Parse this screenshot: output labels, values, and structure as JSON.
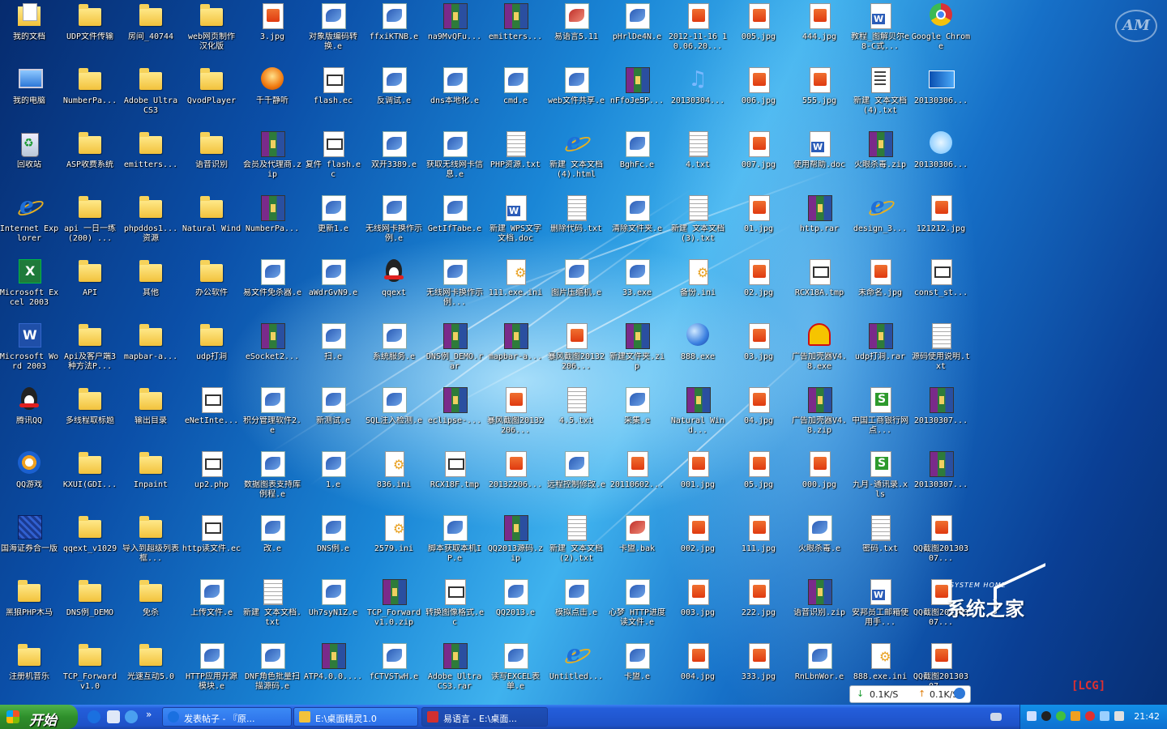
{
  "desktop": {
    "icons": [
      {
        "label": "我的文档",
        "type": "mydocs"
      },
      {
        "label": "我的电脑",
        "type": "computer"
      },
      {
        "label": "回收站",
        "type": "recycle"
      },
      {
        "label": "Internet Explorer",
        "type": "ie"
      },
      {
        "label": "Microsoft Excel 2003",
        "type": "excelapp"
      },
      {
        "label": "Microsoft Word 2003",
        "type": "wordapp"
      },
      {
        "label": "腾讯QQ",
        "type": "qq"
      },
      {
        "label": "QQ游戏",
        "type": "qqgame"
      },
      {
        "label": "国海证券合一版",
        "type": "cert"
      },
      {
        "label": "黑狼PHP木马",
        "type": "folder"
      },
      {
        "label": "注册机音乐",
        "type": "folder"
      },
      {
        "label": "UDP文件传输",
        "type": "folder"
      },
      {
        "label": "NumberPa...",
        "type": "folder"
      },
      {
        "label": "ASP收费系统",
        "type": "folder"
      },
      {
        "label": "api 一日一练(200) ...",
        "type": "folder"
      },
      {
        "label": "API",
        "type": "folder"
      },
      {
        "label": "Api及客户端3种方法P...",
        "type": "folder"
      },
      {
        "label": "多线程取标题",
        "type": "folder"
      },
      {
        "label": "KXUI(GDI...",
        "type": "folder"
      },
      {
        "label": "qqext_v1029",
        "type": "folder"
      },
      {
        "label": "DNS例_DEMO",
        "type": "folder"
      },
      {
        "label": "TCP_Forward v1.0",
        "type": "folder"
      },
      {
        "label": "房间_40744",
        "type": "folder"
      },
      {
        "label": "Adobe Ultra CS3",
        "type": "folder"
      },
      {
        "label": "emitters...",
        "type": "folder"
      },
      {
        "label": "phpddos1...资源",
        "type": "folder"
      },
      {
        "label": "其他",
        "type": "folder"
      },
      {
        "label": "mapbar-a...",
        "type": "folder"
      },
      {
        "label": "输出目录",
        "type": "folder"
      },
      {
        "label": "Inpaint",
        "type": "folder"
      },
      {
        "label": "导入到超级列表框...",
        "type": "folder"
      },
      {
        "label": "免杀",
        "type": "folder"
      },
      {
        "label": "光速互动5.0",
        "type": "folder"
      },
      {
        "label": "web网页制作 汉化版",
        "type": "folder"
      },
      {
        "label": "QvodPlayer",
        "type": "folder"
      },
      {
        "label": "语音识别",
        "type": "folder"
      },
      {
        "label": "Natural Wind",
        "type": "folder"
      },
      {
        "label": "办公软件",
        "type": "folder"
      },
      {
        "label": "udp打洞",
        "type": "folder"
      },
      {
        "label": "eNetInte...",
        "type": "ec"
      },
      {
        "label": "up2.php",
        "type": "ec"
      },
      {
        "label": "http读文件.ec",
        "type": "ec"
      },
      {
        "label": "上传文件.e",
        "type": "exe"
      },
      {
        "label": "HTTP应用开源模块.e",
        "type": "exe"
      },
      {
        "label": "3.jpg",
        "type": "jpg"
      },
      {
        "label": "千千静听",
        "type": "ttjt"
      },
      {
        "label": "会员及代理商.zip",
        "type": "rar"
      },
      {
        "label": "NumberPa...",
        "type": "rar"
      },
      {
        "label": "易文件免杀器.e",
        "type": "exe"
      },
      {
        "label": "eSocket2...",
        "type": "rar"
      },
      {
        "label": "积分管理软件2.e",
        "type": "exe"
      },
      {
        "label": "数据图表支持库例程.e",
        "type": "exe"
      },
      {
        "label": "改.e",
        "type": "exe"
      },
      {
        "label": "新建 文本文档.txt",
        "type": "txt"
      },
      {
        "label": "DNF角色批量扫描源码.e",
        "type": "exe"
      },
      {
        "label": "对象版编码转换.e",
        "type": "exe"
      },
      {
        "label": "flash.ec",
        "type": "ec"
      },
      {
        "label": "复件 flash.ec",
        "type": "ec"
      },
      {
        "label": "更新1.e",
        "type": "exe"
      },
      {
        "label": "aWdrGvN9.e",
        "type": "exe"
      },
      {
        "label": "扫.e",
        "type": "exe"
      },
      {
        "label": "新测试.e",
        "type": "exe"
      },
      {
        "label": "1.e",
        "type": "exe"
      },
      {
        "label": "DNS例.e",
        "type": "exe"
      },
      {
        "label": "Uh7syN1Z.e",
        "type": "exe"
      },
      {
        "label": "ATP4.0.0....",
        "type": "rar"
      },
      {
        "label": "ffxiKTNB.e",
        "type": "exe"
      },
      {
        "label": "反调试.e",
        "type": "exe"
      },
      {
        "label": "双开3389.e",
        "type": "exe"
      },
      {
        "label": "无线网卡换作示例.e",
        "type": "exe"
      },
      {
        "label": "qqext",
        "type": "qq"
      },
      {
        "label": "系统服务.e",
        "type": "exe"
      },
      {
        "label": "SQL注入检测.e",
        "type": "exe"
      },
      {
        "label": "836.ini",
        "type": "ini"
      },
      {
        "label": "2579.ini",
        "type": "ini"
      },
      {
        "label": "TCP_Forward v1.0.zip",
        "type": "rar"
      },
      {
        "label": "fCTVSTwH.e",
        "type": "exe"
      },
      {
        "label": "na9MvQFu...",
        "type": "rar"
      },
      {
        "label": "dns本地化.e",
        "type": "exe"
      },
      {
        "label": "获取无线网卡信息.e",
        "type": "exe"
      },
      {
        "label": "GetIfTabe.e",
        "type": "exe"
      },
      {
        "label": "无线网卡换作示例...",
        "type": "exe"
      },
      {
        "label": "DNS例_DEMO.rar",
        "type": "rar"
      },
      {
        "label": "eclipse-...",
        "type": "rar"
      },
      {
        "label": "RCX18F.tmp",
        "type": "ec"
      },
      {
        "label": "脚本获取本机IP.e",
        "type": "exe"
      },
      {
        "label": "转换图像格式.ec",
        "type": "ec"
      },
      {
        "label": "Adobe Ultra CS3.rar",
        "type": "rar"
      },
      {
        "label": "emitters...",
        "type": "rar"
      },
      {
        "label": "cmd.e",
        "type": "exe"
      },
      {
        "label": "PHP资源.txt",
        "type": "txt"
      },
      {
        "label": "新建 WPS文字 文档.doc",
        "type": "doc"
      },
      {
        "label": "111.exe.ini",
        "type": "ini"
      },
      {
        "label": "mapbar-a...",
        "type": "rar"
      },
      {
        "label": "暴风截图20132206...",
        "type": "jpg"
      },
      {
        "label": "20132206...",
        "type": "jpg"
      },
      {
        "label": "QQ2013源码.zip",
        "type": "rar"
      },
      {
        "label": "QQ2013.e",
        "type": "exe"
      },
      {
        "label": "读写EXCEL表单.e",
        "type": "exe"
      },
      {
        "label": "易语言5.11",
        "type": "exe",
        "red": true
      },
      {
        "label": "web文件共享.e",
        "type": "exe"
      },
      {
        "label": "新建 文本文档 (4).html",
        "type": "ie"
      },
      {
        "label": "删除代码.txt",
        "type": "txt"
      },
      {
        "label": "图片压缩机.e",
        "type": "exe"
      },
      {
        "label": "暴风截图20132206...",
        "type": "jpg"
      },
      {
        "label": "4.5.txt",
        "type": "txt"
      },
      {
        "label": "远程控制修改.e",
        "type": "exe"
      },
      {
        "label": "新建 文本文档 (2).txt",
        "type": "txt"
      },
      {
        "label": "模拟点击.e",
        "type": "exe"
      },
      {
        "label": "Untitled...",
        "type": "ie"
      },
      {
        "label": "pHrlDe4N.e",
        "type": "exe"
      },
      {
        "label": "nFfoJe5P...",
        "type": "rar"
      },
      {
        "label": "BghFc.e",
        "type": "exe"
      },
      {
        "label": "清除文件夹.e",
        "type": "exe"
      },
      {
        "label": "33.exe",
        "type": "exe"
      },
      {
        "label": "新建文件夹.zip",
        "type": "rar"
      },
      {
        "label": "采集.e",
        "type": "exe"
      },
      {
        "label": "20110602...",
        "type": "jpg"
      },
      {
        "label": "卡盟.bak",
        "type": "exe",
        "red": true
      },
      {
        "label": "心梦 HTTP进度读文件.e",
        "type": "exe"
      },
      {
        "label": "卡盟.e",
        "type": "exe"
      },
      {
        "label": "2012-11-16 10.06.20...",
        "type": "jpg"
      },
      {
        "label": "20130304...",
        "type": "music"
      },
      {
        "label": "4.txt",
        "type": "txt"
      },
      {
        "label": "新建 文本文档 (3).txt",
        "type": "txt"
      },
      {
        "label": "备份.ini",
        "type": "ini"
      },
      {
        "label": "888.exe",
        "type": "globe"
      },
      {
        "label": "Natural Wind...",
        "type": "rar"
      },
      {
        "label": "001.jpg",
        "type": "jpg"
      },
      {
        "label": "002.jpg",
        "type": "jpg"
      },
      {
        "label": "003.jpg",
        "type": "jpg"
      },
      {
        "label": "004.jpg",
        "type": "jpg"
      },
      {
        "label": "005.jpg",
        "type": "jpg"
      },
      {
        "label": "006.jpg",
        "type": "jpg"
      },
      {
        "label": "007.jpg",
        "type": "jpg"
      },
      {
        "label": "01.jpg",
        "type": "jpg"
      },
      {
        "label": "02.jpg",
        "type": "jpg"
      },
      {
        "label": "03.jpg",
        "type": "jpg"
      },
      {
        "label": "04.jpg",
        "type": "jpg"
      },
      {
        "label": "05.jpg",
        "type": "jpg"
      },
      {
        "label": "111.jpg",
        "type": "jpg"
      },
      {
        "label": "222.jpg",
        "type": "jpg"
      },
      {
        "label": "333.jpg",
        "type": "jpg"
      },
      {
        "label": "444.jpg",
        "type": "jpg"
      },
      {
        "label": "555.jpg",
        "type": "jpg"
      },
      {
        "label": "使用帮助.doc",
        "type": "doc"
      },
      {
        "label": "http.rar",
        "type": "rar"
      },
      {
        "label": "RCX18A.tmp",
        "type": "ec"
      },
      {
        "label": "广告加壳器V4.8.exe",
        "type": "shell"
      },
      {
        "label": "广告加壳器V4.8.zip",
        "type": "rar"
      },
      {
        "label": "000.jpg",
        "type": "jpg"
      },
      {
        "label": "火眼杀毒.e",
        "type": "exe"
      },
      {
        "label": "语音识别.zip",
        "type": "rar"
      },
      {
        "label": "RnLbnWor.e",
        "type": "exe"
      },
      {
        "label": "教程_图解贝尔e8-C式...",
        "type": "doc"
      },
      {
        "label": "新建 文本文档 (4).txt",
        "type": "note"
      },
      {
        "label": "火眼杀毒.zip",
        "type": "rar"
      },
      {
        "label": "design_3...",
        "type": "ie"
      },
      {
        "label": "未命名.jpg",
        "type": "jpg"
      },
      {
        "label": "udp打洞.rar",
        "type": "rar"
      },
      {
        "label": "中国工商银行网点...",
        "type": "xls"
      },
      {
        "label": "九月-通讯录.xls",
        "type": "xls"
      },
      {
        "label": "密码.txt",
        "type": "txt"
      },
      {
        "label": "安邦员工邮箱使用手...",
        "type": "doc"
      },
      {
        "label": "888.exe.ini",
        "type": "ini"
      },
      {
        "label": "Google Chrome",
        "type": "chrome"
      },
      {
        "label": "20130306...",
        "type": "bluebox"
      },
      {
        "label": "20130306...",
        "type": "newico"
      },
      {
        "label": "121212.jpg",
        "type": "jpg"
      },
      {
        "label": "const_st...",
        "type": "ec"
      },
      {
        "label": "源码使用说明.txt",
        "type": "txt"
      },
      {
        "label": "20130307...",
        "type": "rar"
      },
      {
        "label": "20130307...",
        "type": "rar"
      },
      {
        "label": "QQ截图20130307...",
        "type": "jpg"
      },
      {
        "label": "QQ截图20130307...",
        "type": "jpg"
      },
      {
        "label": "QQ截图20130307...",
        "type": "jpg"
      }
    ]
  },
  "watermark": {
    "home_small": "SYSTEM HOME",
    "home_big": "系统之家",
    "lcg": "[LCG]",
    "logo": "AM"
  },
  "speed": {
    "down_arrow": "↓",
    "down": "0.1K/S",
    "up_arrow": "↑",
    "up": "0.1K/S"
  },
  "taskbar": {
    "start_label": "开始",
    "quick_launch_expand": "»",
    "buttons": [
      {
        "label": "发表帖子 - 『原...",
        "icon": "sogou-icon"
      },
      {
        "label": "E:\\桌面精灵1.0",
        "icon": "folder-icon"
      },
      {
        "label": "易语言 - E:\\桌面...",
        "icon": "eyuyan-icon"
      }
    ],
    "clock": "21:42"
  },
  "colors": {
    "taskbar": "#245edb",
    "start": "#2e8f2b",
    "tray": "#0d6fd0"
  }
}
